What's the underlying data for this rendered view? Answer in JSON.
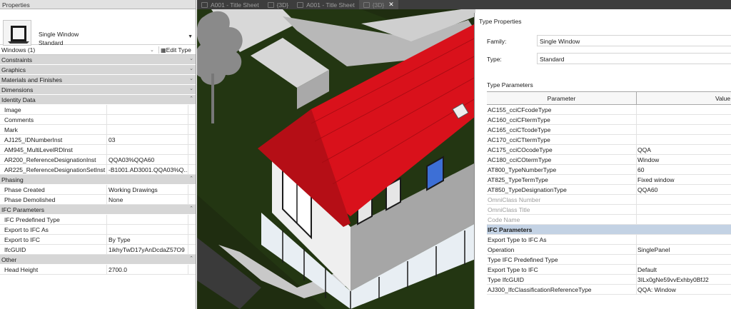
{
  "properties": {
    "title": "Properties",
    "type_selector": {
      "family": "Single Window",
      "type": "Standard"
    },
    "selection": "Windows (1)",
    "edit_type": "Edit Type",
    "groups": [
      {
        "name": "Constraints",
        "rows": []
      },
      {
        "name": "Graphics",
        "rows": []
      },
      {
        "name": "Materials and Finishes",
        "rows": []
      },
      {
        "name": "Dimensions",
        "rows": []
      },
      {
        "name": "Identity Data",
        "rows": [
          {
            "name": "Image",
            "value": ""
          },
          {
            "name": "Comments",
            "value": ""
          },
          {
            "name": "Mark",
            "value": ""
          },
          {
            "name": "AJ125_IDNumberInst",
            "value": "03"
          },
          {
            "name": "AM945_MultiLevelRDInst",
            "value": ""
          },
          {
            "name": "AR200_ReferenceDesignationInst",
            "value": "QQA03%QQA60"
          },
          {
            "name": "AR225_ReferenceDesignationSetInst",
            "value": "-B1001.AD3001.QQA03%Q..."
          }
        ]
      },
      {
        "name": "Phasing",
        "rows": [
          {
            "name": "Phase Created",
            "value": "Working Drawings"
          },
          {
            "name": "Phase Demolished",
            "value": "None"
          }
        ]
      },
      {
        "name": "IFC Parameters",
        "rows": [
          {
            "name": "IFC Predefined Type",
            "value": ""
          },
          {
            "name": "Export to IFC As",
            "value": ""
          },
          {
            "name": "Export to IFC",
            "value": "By Type"
          },
          {
            "name": "IfcGUID",
            "value": "1ikhyTwD17yAnDcdaZ57O9"
          }
        ]
      },
      {
        "name": "Other",
        "rows": [
          {
            "name": "Head Height",
            "value": "2700.0"
          }
        ]
      }
    ]
  },
  "tabs": [
    {
      "label": "A001 - Title Sheet",
      "active": false
    },
    {
      "label": "{3D}",
      "active": false
    },
    {
      "label": "A001 - Title Sheet",
      "active": false
    },
    {
      "label": "{3D}",
      "active": true
    }
  ],
  "tab_close": "✕",
  "viewport": {
    "roof_color": "#d9111b",
    "wall_color": "#9a9a9a",
    "ground_color": "#1f2d10"
  },
  "type_properties": {
    "title": "Type Properties",
    "family_label": "Family:",
    "family_value": "Single Window",
    "type_label": "Type:",
    "type_value": "Standard",
    "section_label": "Type Parameters",
    "col_parameter": "Parameter",
    "col_value": "Value",
    "rows": [
      {
        "name": "AC155_cciCFcodeType",
        "value": "",
        "dim": false
      },
      {
        "name": "AC160_cciCFtermType",
        "value": "",
        "dim": false
      },
      {
        "name": "AC165_cciCTcodeType",
        "value": "",
        "dim": false
      },
      {
        "name": "AC170_cciCTtermType",
        "value": "",
        "dim": false
      },
      {
        "name": "AC175_cciCOcodeType",
        "value": "QQA",
        "dim": false
      },
      {
        "name": "AC180_cciCOtermType",
        "value": "Window",
        "dim": false
      },
      {
        "name": "AT800_TypeNumberType",
        "value": "60",
        "dim": false
      },
      {
        "name": "AT825_TypeTermType",
        "value": "Fixed window",
        "dim": false
      },
      {
        "name": "AT850_TypeDesignationType",
        "value": "QQA60",
        "dim": false
      },
      {
        "name": "OmniClass Number",
        "value": "",
        "dim": true
      },
      {
        "name": "OmniClass Title",
        "value": "",
        "dim": true
      },
      {
        "name": "Code Name",
        "value": "",
        "dim": true
      }
    ],
    "ifc_header": "IFC Parameters",
    "ifc_rows": [
      {
        "name": "Export Type to IFC As",
        "value": ""
      },
      {
        "name": "Operation",
        "value": "SinglePanel"
      },
      {
        "name": "Type IFC Predefined Type",
        "value": ""
      },
      {
        "name": "Export Type to IFC",
        "value": "Default"
      },
      {
        "name": "Type IfcGUID",
        "value": "3ILx0gNe59vvExhby0BfJ2"
      },
      {
        "name": "AJ300_IfcClassificationReferenceType",
        "value": "QQA: Window"
      }
    ]
  }
}
